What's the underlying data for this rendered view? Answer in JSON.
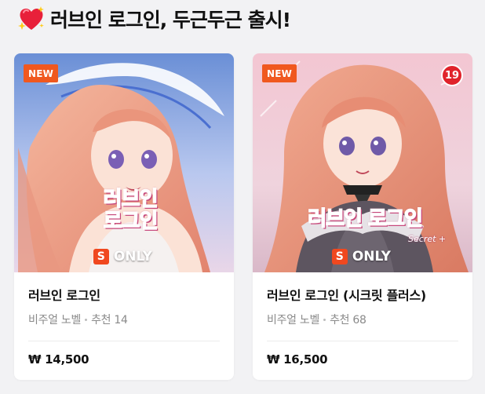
{
  "section": {
    "title": "러브인 로그인, 두근두근 출시!",
    "icon": "sparkling-heart-icon"
  },
  "colors": {
    "new_badge": "#f0581f",
    "age_badge": "#e0232b",
    "s_icon": "#f0481f",
    "logo_pink": "#ff7fb0"
  },
  "cards": [
    {
      "badge": "NEW",
      "cover_logo": "러브인 로그인",
      "only_label": "ONLY",
      "s_mark": "S",
      "title": "러브인 로그인",
      "category": "비주얼 노벨",
      "recommend": "추천 14",
      "price": "₩ 14,500"
    },
    {
      "badge": "NEW",
      "age_rating": "19",
      "cover_logo": "러브인 로그인",
      "cover_sub": "Secret +",
      "only_label": "ONLY",
      "s_mark": "S",
      "title": "러브인 로그인 (시크릿 플러스)",
      "category": "비주얼 노벨",
      "recommend": "추천 68",
      "price": "₩ 16,500"
    }
  ]
}
